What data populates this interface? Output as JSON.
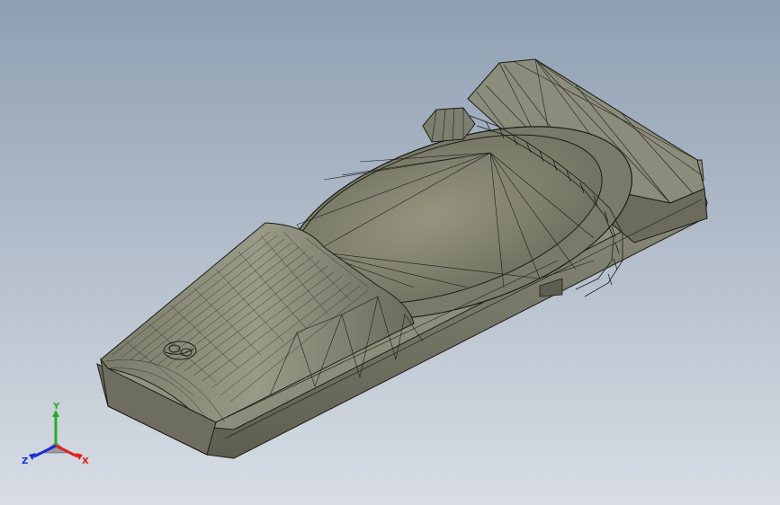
{
  "viewport": {
    "background_top": "#8f9fb2",
    "background_bottom": "#d8dde5"
  },
  "model": {
    "name": "mesh-model",
    "fill_color": "#8a8a7a",
    "shade_color": "#6e6e60",
    "light_color": "#a5a593",
    "edge_color": "#1c1c16",
    "render_mode": "shaded-with-edges"
  },
  "triad": {
    "x_label": "X",
    "y_label": "Y",
    "z_label": "Z",
    "x_color": "#e0201c",
    "y_color": "#22b022",
    "z_color": "#1c2cd8"
  }
}
